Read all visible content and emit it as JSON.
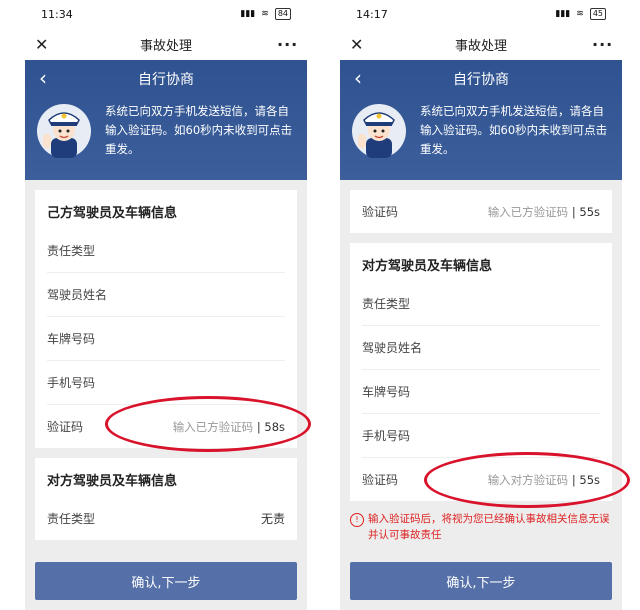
{
  "accent_red": "#d8132b",
  "brand_blue": "#2f5290",
  "left": {
    "time": "11:34",
    "battery": "84",
    "title": "事故处理",
    "banner_title": "自行协商",
    "banner_msg": "系统已向双方手机发送短信，请各自输入验证码。如60秒内未收到可点击重发。",
    "own_title": "己方驾驶员及车辆信息",
    "own_fields": [
      "责任类型",
      "驾驶员姓名",
      "车牌号码",
      "手机号码"
    ],
    "verify_label": "验证码",
    "verify_placeholder": "输入已方验证码",
    "verify_sep": "|",
    "verify_count": "58s",
    "other_title": "对方驾驶员及车辆信息",
    "other_field": "责任类型",
    "other_value": "无责",
    "confirm": "确认,下一步"
  },
  "right": {
    "time": "14:17",
    "battery": "45",
    "title": "事故处理",
    "banner_title": "自行协商",
    "banner_msg": "系统已向双方手机发送短信，请各自输入验证码。如60秒内未收到可点击重发。",
    "own_verify_label": "验证码",
    "own_verify_placeholder": "输入已方验证码",
    "own_verify_sep": "|",
    "own_verify_count": "55s",
    "other_title": "对方驾驶员及车辆信息",
    "other_fields": [
      "责任类型",
      "驾驶员姓名",
      "车牌号码",
      "手机号码"
    ],
    "verify_label": "验证码",
    "verify_placeholder": "输入对方验证码",
    "verify_sep": "|",
    "verify_count": "55s",
    "warning": "输入验证码后，将视为您已经确认事故相关信息无误并认可事故责任",
    "confirm": "确认,下一步"
  }
}
